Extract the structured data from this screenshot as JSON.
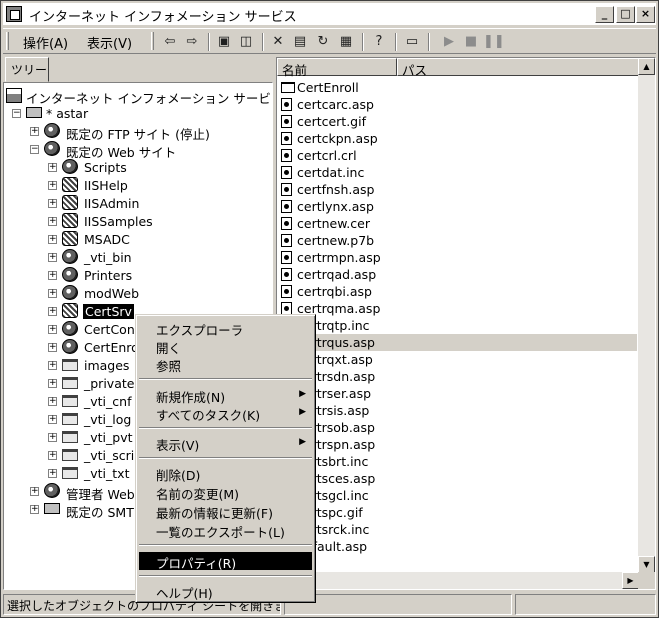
{
  "window": {
    "title": "インターネット インフォメーション サービス"
  },
  "menubar": {
    "action": "操作(A)",
    "view": "表示(V)"
  },
  "toolbar_icons": [
    "back-arrow-icon",
    "forward-arrow-icon",
    "up-folder-icon",
    "show-tree-icon",
    "delete-icon",
    "properties-icon",
    "refresh-icon",
    "export-list-icon",
    "help-icon",
    "computer-icon",
    "play-icon",
    "stop-icon",
    "pause-icon"
  ],
  "tree": {
    "tab_label": "ツリー",
    "root": "インターネット インフォメーション サービス",
    "server": "* astar",
    "ftp_site": "既定の FTP サイト (停止)",
    "web_site": "既定の Web サイト",
    "web_children": [
      "Scripts",
      "IISHelp",
      "IISAdmin",
      "IISSamples",
      "MSADC",
      "_vti_bin",
      "Printers",
      "modWeb",
      "CertSrv",
      "CertControl",
      "CertEnroll",
      "images",
      "_private",
      "_vti_cnf",
      "_vti_log",
      "_vti_pvt",
      "_vti_script",
      "_vti_txt"
    ],
    "admin_site": "管理者 Web サイト",
    "smtp_site": "既定の SMTP 仮想サーバー"
  },
  "list": {
    "columns": [
      "名前",
      "パス"
    ],
    "rows": [
      "CertEnroll",
      "certcarc.asp",
      "certcert.gif",
      "certckpn.asp",
      "certcrl.crl",
      "certdat.inc",
      "certfnsh.asp",
      "certlynx.asp",
      "certnew.cer",
      "certnew.p7b",
      "certrmpn.asp",
      "certrqad.asp",
      "certrqbi.asp",
      "certrqma.asp",
      "certrqtp.inc",
      "certrqus.asp",
      "certrqxt.asp",
      "certrsdn.asp",
      "certrser.asp",
      "certrsis.asp",
      "certrsob.asp",
      "certrspn.asp",
      "certsbrt.inc",
      "certsces.asp",
      "certsgcl.inc",
      "certspc.gif",
      "certsrck.inc",
      "default.asp"
    ]
  },
  "context_menu": {
    "group1": [
      "エクスプローラ",
      "開く",
      "参照"
    ],
    "group2": [
      "新規作成(N)",
      "すべてのタスク(K)"
    ],
    "group3": [
      "表示(V)"
    ],
    "group4": [
      "削除(D)",
      "名前の変更(M)",
      "最新の情報に更新(F)",
      "一覧のエクスポート(L)"
    ],
    "group5": [
      "プロパティ(R)"
    ],
    "group6": [
      "ヘルプ(H)"
    ]
  },
  "status": {
    "text": "選択したオブジェクトのプロパティ シートを開きます。"
  }
}
